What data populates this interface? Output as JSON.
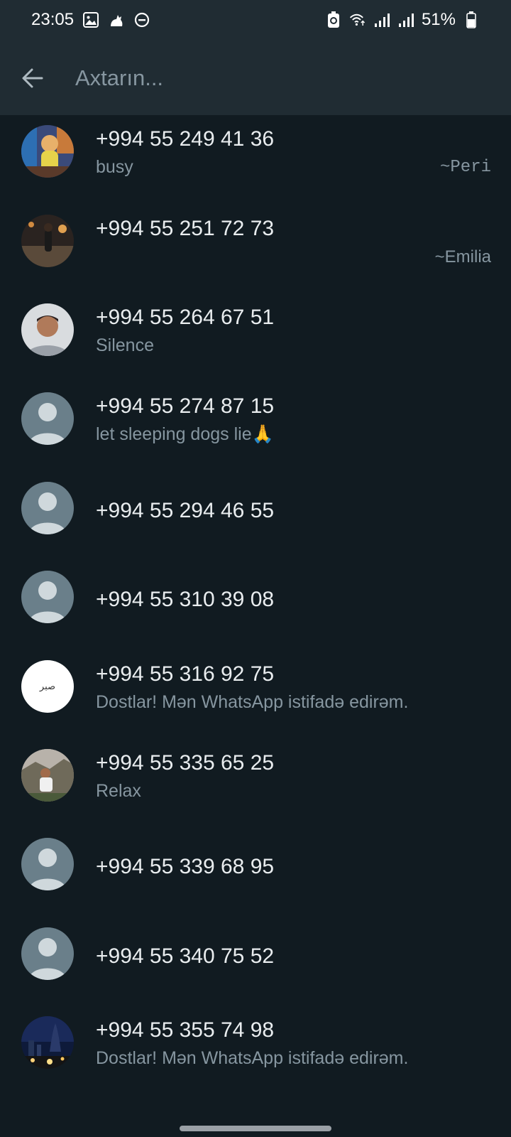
{
  "status_bar": {
    "time": "23:05",
    "battery": "51%",
    "left_icons": [
      "image-icon",
      "cat-icon",
      "do-not-disturb-icon"
    ],
    "right_icons": [
      "battery-saver-icon",
      "wifi-icon",
      "signal-icon",
      "signal-icon-2",
      "battery-icon"
    ]
  },
  "search": {
    "placeholder": "Axtarın...",
    "value": ""
  },
  "contacts": [
    {
      "number": "+994 55 249 41 36",
      "status": "busy",
      "pushname": "~Peri",
      "avatar": "photo-girl"
    },
    {
      "number": "+994 55 251 72 73",
      "status": "",
      "pushname": "~Emilia",
      "avatar": "photo-street"
    },
    {
      "number": "+994 55 264 67 51",
      "status": "Silence",
      "pushname": "",
      "avatar": "photo-man"
    },
    {
      "number": "+994 55 274 87 15",
      "status": "let sleeping dogs lie🙏",
      "pushname": "",
      "avatar": "default"
    },
    {
      "number": "+994 55 294 46 55",
      "status": "",
      "pushname": "",
      "avatar": "default"
    },
    {
      "number": "+994 55 310 39 08",
      "status": "",
      "pushname": "",
      "avatar": "default"
    },
    {
      "number": "+994 55 316 92 75",
      "status": "Dostlar! Mən WhatsApp istifadə edirəm.",
      "pushname": "",
      "avatar": "white-arabic"
    },
    {
      "number": "+994 55 335 65 25",
      "status": "Relax",
      "pushname": "",
      "avatar": "photo-outdoor"
    },
    {
      "number": "+994 55 339 68 95",
      "status": "",
      "pushname": "",
      "avatar": "default"
    },
    {
      "number": "+994 55 340 75 52",
      "status": "",
      "pushname": "",
      "avatar": "default"
    },
    {
      "number": "+994 55 355 74 98",
      "status": "Dostlar! Mən WhatsApp istifadə edirəm.",
      "pushname": "",
      "avatar": "photo-night-city"
    }
  ],
  "avatar_text": {
    "white-arabic": "صبر"
  },
  "colors": {
    "background": "#111b21",
    "header": "#202c33",
    "primary_text": "#e9edef",
    "secondary_text": "#8696a0",
    "default_avatar": "#6a7f8a"
  }
}
